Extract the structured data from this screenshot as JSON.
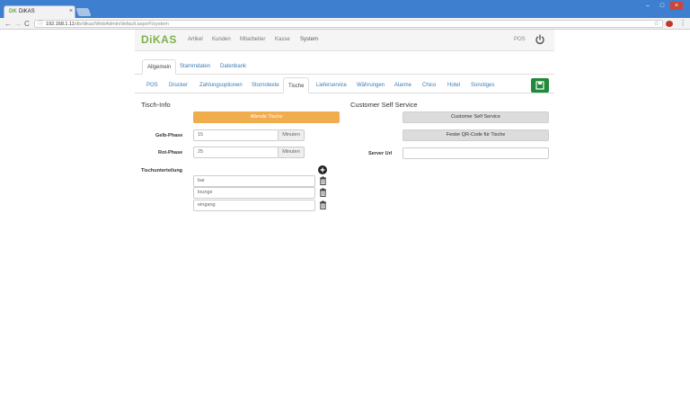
{
  "browser": {
    "tab_title": "DiKAS",
    "tab_favicon": "DK",
    "tab_close": "×",
    "url_host": "192.168.1.11",
    "url_path": "/db/dikas/WebAdmin/default.aspx#!/system",
    "back_icon": "←",
    "forward_icon": "→",
    "reload_icon": "C",
    "star_icon": "☆",
    "menu_icon": "⋮",
    "info_icon": "ⓘ",
    "win_min": "–",
    "win_max": "□",
    "win_close": "×"
  },
  "app": {
    "logo": "DiKAS",
    "nav": [
      "Artikel",
      "Kunden",
      "Mitarbeiter",
      "Kasse",
      "System"
    ],
    "pos_link": "POS",
    "power_icon": "power-icon"
  },
  "tabs_primary": [
    "Allgemein",
    "Stammdaten",
    "Datenbank"
  ],
  "tabs_secondary": [
    "POS",
    "Drucker",
    "Zahlungsoptionen",
    "Stornotexte",
    "Tische",
    "Lieferservice",
    "Währungen",
    "Alarme",
    "Chico",
    "Hotel",
    "Sonstiges"
  ],
  "tisch_info": {
    "title": "Tisch-Info",
    "button_label": "Allende Tische",
    "gelb_label": "Gelb-Phase",
    "gelb_value": "15",
    "gelb_unit": "Minuten",
    "rot_label": "Rot-Phase",
    "rot_value": "25",
    "rot_unit": "Minuten",
    "tischunterteilung_label": "Tischunterteilung",
    "items": [
      "bar",
      "lounge",
      "eingang"
    ]
  },
  "self_service": {
    "title": "Customer Self Service",
    "button1": "Customer Self Service",
    "button2": "Fester QR-Code für Tische",
    "server_label": "Server Url",
    "server_value": ""
  },
  "colors": {
    "accent_orange": "#f0ad4e",
    "save_green": "#1f8a3a",
    "link_blue": "#3a7ab8",
    "logo_green": "#7fb24a",
    "chrome_blue": "#3f7fcf"
  }
}
